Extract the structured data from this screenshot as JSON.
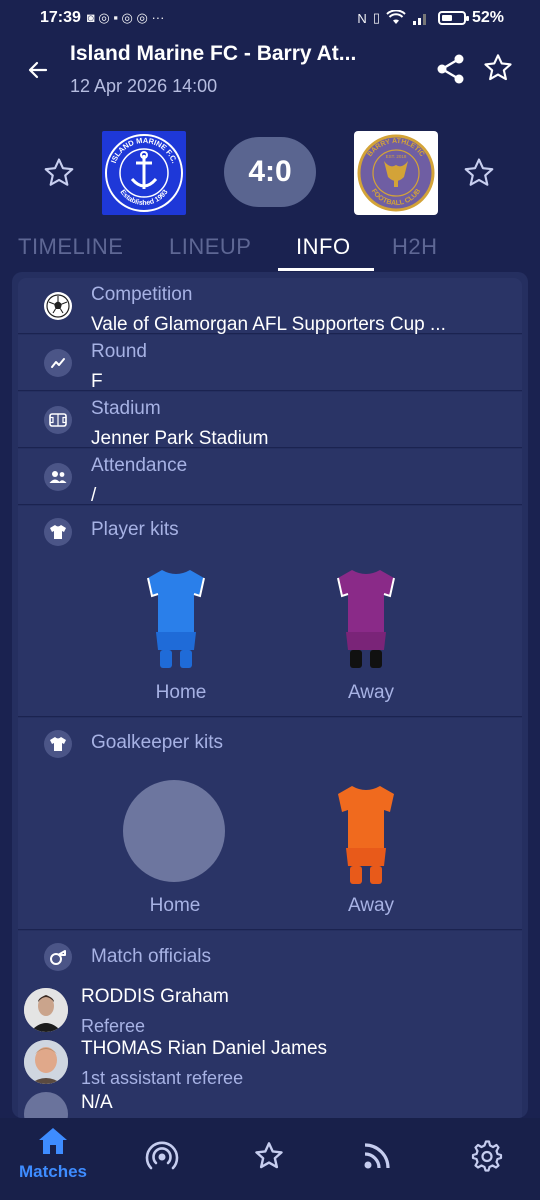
{
  "status_bar": {
    "time": "17:39",
    "battery": "52%",
    "battery_level": 0.52
  },
  "header": {
    "title": "Island Marine FC - Barry At...",
    "subtitle": "12 Apr 2026 14:00",
    "back_icon": "arrow-left-icon",
    "share_icon": "share-icon",
    "favorite_icon": "star-outline-icon"
  },
  "match": {
    "home_logo_text_top": "ISLAND MARINE F.C.",
    "home_logo_text_bottom": "Established 1993",
    "away_logo_text_top": "BARRY ATHLETIC",
    "away_logo_text_mid": "EST. 2018",
    "away_logo_text_bottom": "FOOTBALL CLUB",
    "score": "4:0"
  },
  "tabs": [
    {
      "label": "TIMELINE"
    },
    {
      "label": "LINEUP"
    },
    {
      "label": "INFO"
    },
    {
      "label": "H2H"
    }
  ],
  "info": {
    "competition_label": "Competition",
    "competition_value": "Vale of Glamorgan AFL Supporters Cup ...",
    "round_label": "Round",
    "round_value": "F",
    "stadium_label": "Stadium",
    "stadium_value": "Jenner Park Stadium",
    "attendance_label": "Attendance",
    "attendance_value": "/"
  },
  "player_kits": {
    "title": "Player kits",
    "home_label": "Home",
    "away_label": "Away",
    "home_color": "#2a7fea",
    "away_color": "#8a2a88"
  },
  "goalkeeper_kits": {
    "title": "Goalkeeper kits",
    "home_label": "Home",
    "away_label": "Away",
    "away_color": "#f06a1e"
  },
  "officials": {
    "title": "Match officials",
    "list": [
      {
        "name": "RODDIS Graham",
        "role": "Referee"
      },
      {
        "name": "THOMAS Rian Daniel James",
        "role": "1st assistant referee"
      },
      {
        "name": "N/A",
        "role": ""
      }
    ]
  },
  "bottom_nav": {
    "matches_label": "Matches",
    "accent": "#3e8cff"
  }
}
